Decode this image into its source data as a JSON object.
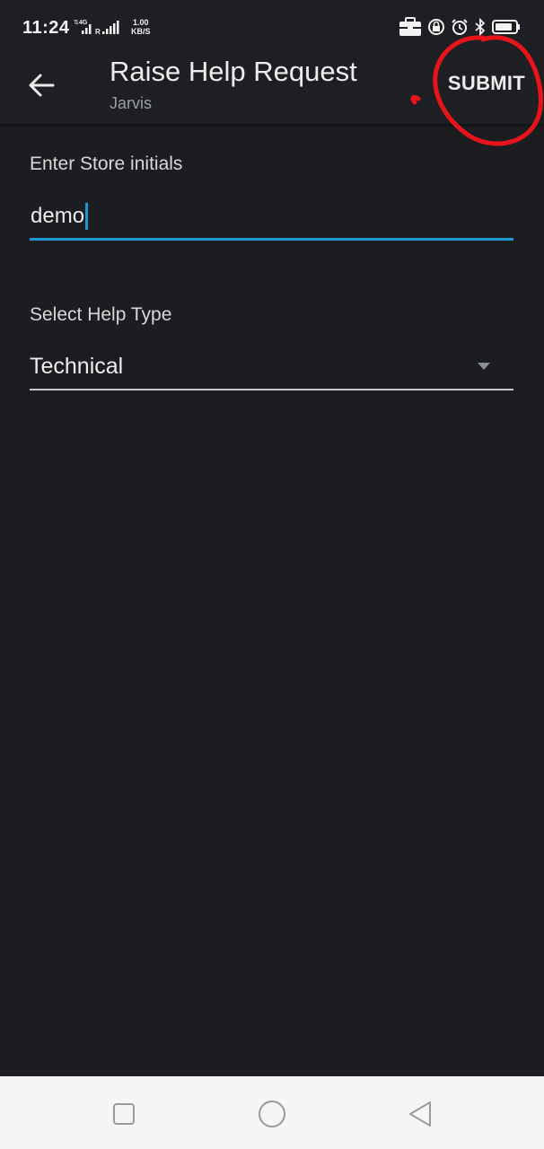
{
  "status_bar": {
    "time": "11:24",
    "network": "4G",
    "roaming": "R",
    "speed_value": "1.00",
    "speed_unit": "KB/S",
    "icons": [
      "briefcase-icon",
      "lock-rotation-icon",
      "alarm-icon",
      "bluetooth-icon",
      "battery-icon"
    ]
  },
  "app_bar": {
    "title": "Raise Help Request",
    "subtitle": "Jarvis",
    "submit_label": "SUBMIT",
    "back_icon": "arrow-back-icon"
  },
  "form": {
    "store_label": "Enter Store initials",
    "store_value": "demo",
    "help_type_label": "Select Help Type",
    "help_type_value": "Technical"
  },
  "nav_bar": {
    "icons": [
      "recents-square-icon",
      "home-circle-icon",
      "back-triangle-icon"
    ]
  },
  "colors": {
    "background": "#1b1d21",
    "accent": "#1e96d3",
    "annotation": "#e8141c",
    "nav_bar": "#f5f5f5"
  }
}
